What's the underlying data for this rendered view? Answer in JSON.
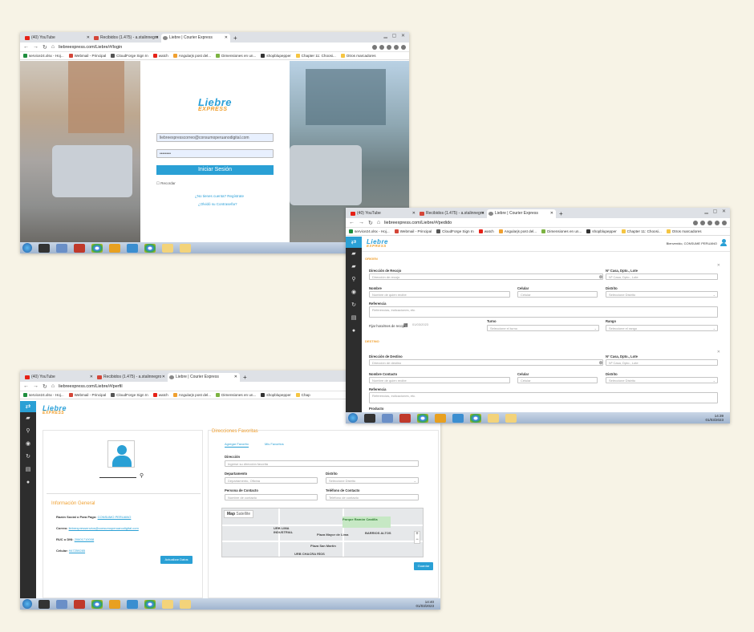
{
  "window1": {
    "tabs": [
      {
        "label": "(40) YouTube",
        "color": "#e62117"
      },
      {
        "label": "Recibidos (1.475) - a.stalinnegro",
        "color": "#d44638"
      },
      {
        "label": "Liebre | Courier Express",
        "color": "#666666"
      }
    ],
    "url": "liebreexpress.com/Liebre/#/login",
    "bookmarks": [
      "service24.xlsx - Hoj...",
      "Webmail - Principal",
      "CloudForge Sign In",
      "watch",
      "Angularjs post del...",
      "Dimensiones en un...",
      "shopblupepper",
      "Chapter 11: Choosi...",
      "Otros marcadores"
    ],
    "login": {
      "email": "liebreexpresscorreo@consumoperuanodigital.com",
      "password": "••••••••",
      "submit": "Iniciar Sesión",
      "remember": "Recordar",
      "register": "¿No tienes cuenta? Regístrate",
      "forgot": "¿Olvidó su Contraseña?"
    }
  },
  "window2": {
    "tabs": [
      {
        "label": "(40) YouTube",
        "color": "#e62117"
      },
      {
        "label": "Recibidos (1.475) - a.stalinnegro",
        "color": "#d44638"
      },
      {
        "label": "Liebre | Courier Express",
        "color": "#666666"
      }
    ],
    "url": "liebreexpress.com/Liebre/#/pedido",
    "bookmarks": [
      "service24.xlsx - Hoj...",
      "Webmail - Principal",
      "CloudForge Sign In",
      "watch",
      "Angularjs post del...",
      "Dimensiones en un...",
      "shopblupepper",
      "Chapter 11: Choosi...",
      "Otros marcadores"
    ],
    "welcome": "Bienvenido, CONSUME PERUANO",
    "origen": {
      "title": "ORIGEN",
      "direccion_label": "Dirección de Recojo",
      "direccion_ph": "Dirección de recojo",
      "nro_label": "Nº Casa, Dpto., Lote",
      "nro_ph": "Nº Casa, Dpto., Lote",
      "nombre_label": "Nombre",
      "nombre_ph": "Nombre de quien recibe",
      "celular_label": "Celular",
      "celular_ph": "Celular",
      "distrito_label": "Distrito",
      "distrito_ph": "Seleccione Distrito",
      "referencia_label": "Referencia",
      "referencia_ph": "Referencias, indicaciones, etc.",
      "fecha_label": "Fijar hora/mes de recojo",
      "fecha_value": "01/03/2023",
      "turno_label": "Turno",
      "turno_ph": "Seleccione el turno",
      "rango_label": "Rango",
      "rango_ph": "Seleccione el rango"
    },
    "destino": {
      "title": "DESTINO",
      "direccion_label": "Dirección de Destino",
      "direccion_ph": "Dirección de destino",
      "nro_label": "Nº Casa, Dpto., Lote",
      "nro_ph": "Nº Casa, Dpto., Lote",
      "nombre_label": "Nombre Contacto",
      "nombre_ph": "Nombre de quien recibe",
      "celular_label": "Celular",
      "celular_ph": "Celular",
      "distrito_label": "Distrito",
      "distrito_ph": "Seleccione Distrito",
      "referencia_label": "Referencia",
      "referencia_ph": "Referencias, indicaciones, etc.",
      "producto_label": "Producto"
    },
    "clock": {
      "time": "14:39",
      "date": "01/03/2023"
    }
  },
  "window3": {
    "tabs": [
      {
        "label": "(40) YouTube",
        "color": "#e62117"
      },
      {
        "label": "Recibidos (1.475) - a.stalinnegro",
        "color": "#d44638"
      },
      {
        "label": "Liebre | Courier Express",
        "color": "#666666"
      }
    ],
    "url": "liebreexpress.com/Liebre/#/perfil",
    "bookmarks": [
      "service24.xlsx - Hoj...",
      "Webmail - Principal",
      "CloudForge Sign In",
      "watch",
      "Angularjs post del...",
      "Dimensiones en un...",
      "shopblupepper",
      "Chap"
    ],
    "info": {
      "title": "Información General",
      "razon_label": "Razón Social o Para Pago:",
      "razon_value": "CONSUMO PERUANO",
      "correo_label": "Correo:",
      "correo_value": "liebrexpressenvios@consumoperuanodigital.com",
      "ruc_label": "RUC o DNI:",
      "ruc_value": "20601710008",
      "celular_label": "Celular:",
      "celular_value": "947259285",
      "update_btn": "Actualizar Datos"
    },
    "favs": {
      "title": "Direcciones Favoritas",
      "tab_add": "Agregar Favorito",
      "tab_list": "Mis Favoritos",
      "direccion_label": "Dirección",
      "direccion_ph": "Ingrese su dirección favorita",
      "depto_label": "Departamento",
      "depto_ph": "Departamento, Oficina",
      "distrito_label": "Distrito",
      "distrito_ph": "Seleccione Distrito",
      "persona_label": "Persona de Contacto",
      "persona_ph": "Nombre de contacto",
      "telefono_label": "Teléfono de Contacto",
      "telefono_ph": "Teléfono de contacto",
      "map_tab": "Map",
      "sat_tab": "Satellite",
      "map_labels": [
        "URB LIMA INDUSTRIAL",
        "Plaza Mayor de Lima",
        "BARRIOS ALTOS",
        "Plaza San Martín",
        "URB CHACRA RÍOS",
        "Parque Ramón Castilla"
      ],
      "save_btn": "Guardar"
    },
    "clock": {
      "time": "14:40",
      "date": "01/03/2023"
    }
  },
  "colors": {
    "brand": "#2aa0d5",
    "accent": "#f0a030",
    "sidebar": "#2d2d2d"
  }
}
